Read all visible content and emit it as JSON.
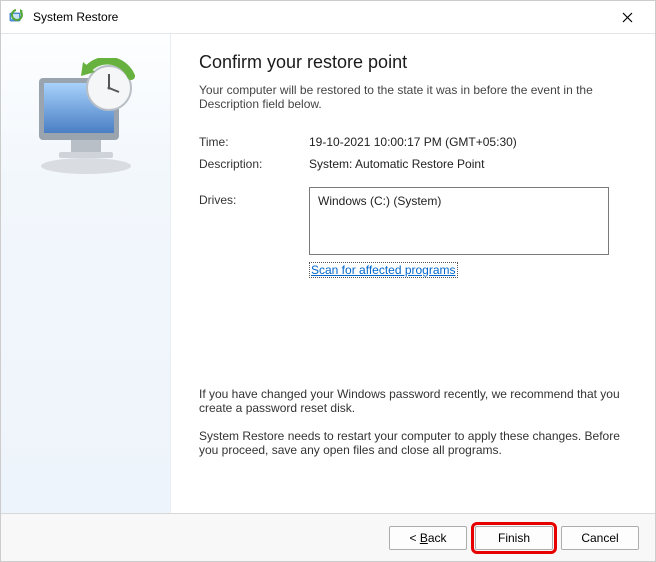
{
  "titlebar": {
    "title": "System Restore"
  },
  "heading": "Confirm your restore point",
  "intro": "Your computer will be restored to the state it was in before the event in the Description field below.",
  "fields": {
    "time_label": "Time:",
    "time_value": "19-10-2021 10:00:17 PM (GMT+05:30)",
    "desc_label": "Description:",
    "desc_value": "System: Automatic Restore Point",
    "drives_label": "Drives:",
    "drives_value": "Windows (C:) (System)"
  },
  "scan_link": "Scan for affected programs",
  "notice1": "If you have changed your Windows password recently, we recommend that you create a password reset disk.",
  "notice2": "System Restore needs to restart your computer to apply these changes. Before you proceed, save any open files and close all programs.",
  "buttons": {
    "back_prefix": "< ",
    "back_u": "B",
    "back_rest": "ack",
    "finish": "Finish",
    "cancel": "Cancel"
  }
}
